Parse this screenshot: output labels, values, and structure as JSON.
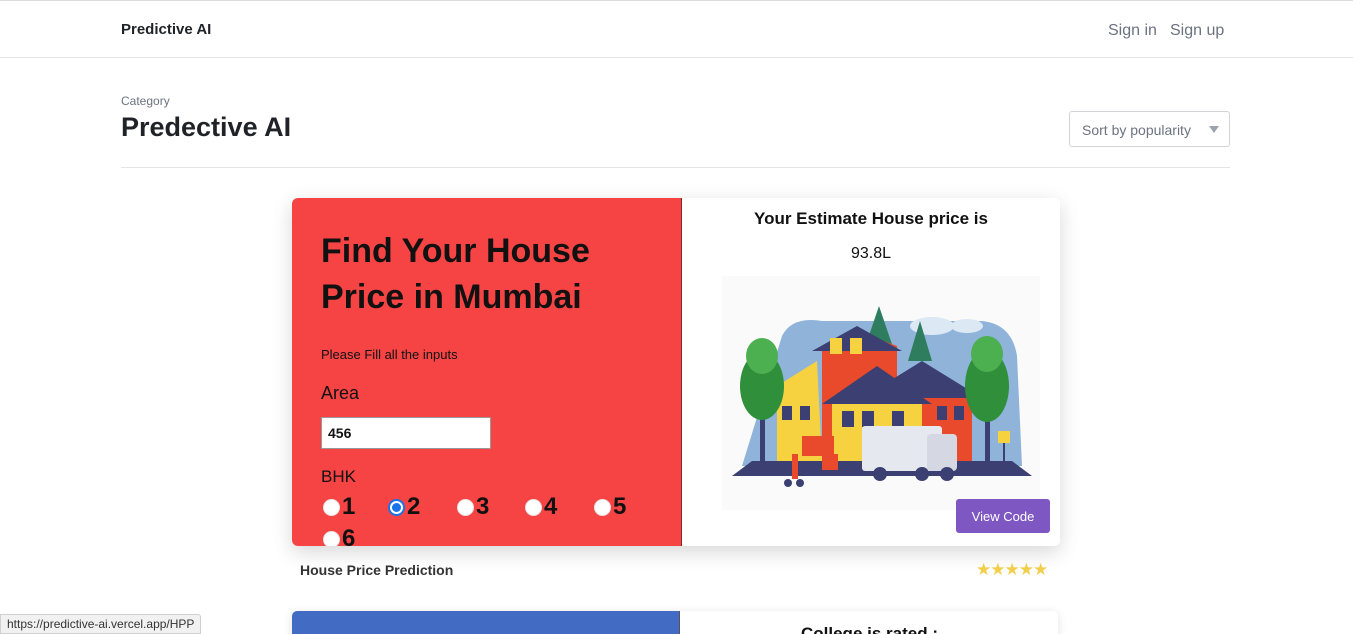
{
  "header": {
    "brand": "Predictive AI",
    "signin": "Sign in",
    "signup": "Sign up"
  },
  "page": {
    "category_label": "Category",
    "title": "Predective AI",
    "sort": {
      "selected": "Sort by popularity"
    }
  },
  "card": {
    "heading": "Find Your House Price in Mumbai",
    "instructions": "Please Fill all the inputs",
    "area_label": "Area",
    "area_value": "456",
    "bhk_label": "BHK",
    "bhk_options": [
      "1",
      "2",
      "3",
      "4",
      "5",
      "6"
    ],
    "bhk_selected": "2",
    "result_title": "Your Estimate House price is",
    "result_value": "93.8L",
    "illustration": "house-illustration",
    "view_code": "View Code",
    "name": "House Price Prediction",
    "stars": "★★★★★",
    "rating": 5,
    "left_color": "#f64343",
    "button_color": "#7e57c2"
  },
  "card2": {
    "title": "College is rated :",
    "left_color": "#426cc4"
  },
  "status_url": "https://predictive-ai.vercel.app/HPP"
}
